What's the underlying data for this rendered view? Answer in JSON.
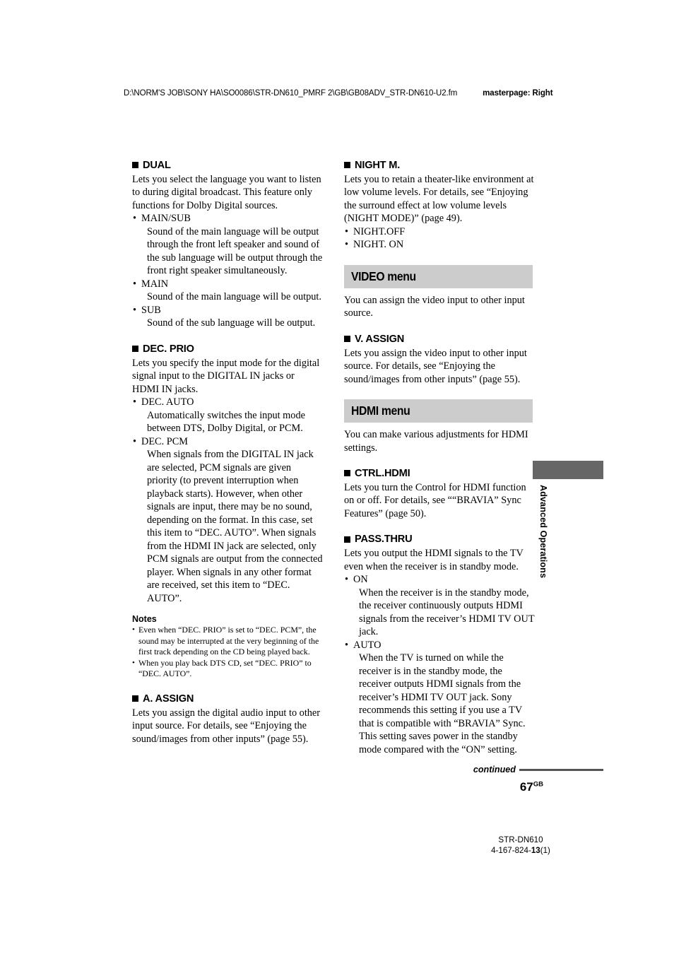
{
  "header": {
    "file_path": "D:\\NORM'S JOB\\SONY HA\\SO0086\\STR-DN610_PMRF 2\\GB\\GB08ADV_STR-DN610-U2.fm",
    "masterpage": "masterpage: Right"
  },
  "side_tab": {
    "label": "Advanced Operations",
    "block_color": "#666666"
  },
  "menu_bar_color": "#cccccc",
  "left_column": {
    "dual": {
      "heading": "DUAL",
      "intro": "Lets you select the language you want to listen to during digital broadcast. This feature only functions for Dolby Digital sources.",
      "options": [
        {
          "name": "MAIN/SUB",
          "desc": "Sound of the main language will be output through the front left speaker and sound of the sub language will be output through the front right speaker simultaneously."
        },
        {
          "name": "MAIN",
          "desc": "Sound of the main language will be output."
        },
        {
          "name": "SUB",
          "desc": "Sound of the sub language will be output."
        }
      ]
    },
    "dec_prio": {
      "heading": "DEC. PRIO",
      "intro": "Lets you specify the input mode for the digital signal input to the DIGITAL IN jacks or HDMI IN jacks.",
      "options": [
        {
          "name": "DEC. AUTO",
          "desc": "Automatically switches the input mode between DTS, Dolby Digital, or PCM."
        },
        {
          "name": "DEC. PCM",
          "desc": "When signals from the DIGITAL IN jack are selected, PCM signals are given priority (to prevent interruption when playback starts). However, when other signals are input, there may be no sound, depending on the format. In this case, set this item to “DEC. AUTO”. When signals from the HDMI IN jack are selected, only PCM signals are output from the connected player. When signals in any other format are received, set this item to “DEC. AUTO”."
        }
      ],
      "notes_title": "Notes",
      "notes": [
        "Even when “DEC. PRIO” is set to “DEC. PCM”, the sound may be interrupted at the very beginning of the first track depending on the CD being played back.",
        "When you play back DTS CD, set “DEC. PRIO” to “DEC. AUTO”."
      ]
    },
    "a_assign": {
      "heading": "A. ASSIGN",
      "intro": "Lets you assign the digital audio input to other input source. For details, see “Enjoying the sound/images from other inputs” (page 55)."
    }
  },
  "right_column": {
    "night_m": {
      "heading": "NIGHT M.",
      "intro": "Lets you to retain a theater-like environment at low volume levels. For details, see “Enjoying the surround effect at low volume levels (NIGHT MODE)” (page 49).",
      "options": [
        {
          "name": "NIGHT.OFF",
          "desc": ""
        },
        {
          "name": "NIGHT. ON",
          "desc": ""
        }
      ]
    },
    "video_menu": {
      "bar_title": "VIDEO menu",
      "intro": "You can assign the video input to other input source.",
      "v_assign": {
        "heading": "V. ASSIGN",
        "intro": "Lets you assign the video input to other input source. For details, see “Enjoying the sound/images from other inputs” (page 55)."
      }
    },
    "hdmi_menu": {
      "bar_title": "HDMI menu",
      "intro": "You can make various adjustments for HDMI settings.",
      "ctrl_hdmi": {
        "heading": "CTRL.HDMI",
        "intro": "Lets you turn the Control for HDMI function on or off. For details, see ““BRAVIA” Sync Features” (page 50)."
      },
      "pass_thru": {
        "heading": "PASS.THRU",
        "intro": "Lets you output the HDMI signals to the TV even when the receiver is in standby mode.",
        "options": [
          {
            "name": "ON",
            "desc": "When the receiver is in the standby mode, the receiver continuously outputs HDMI signals from the receiver’s HDMI TV OUT jack."
          },
          {
            "name": "AUTO",
            "desc": "When the TV is turned on while the receiver is in the standby mode, the receiver outputs HDMI signals from the receiver’s HDMI TV OUT jack. Sony recommends this setting if you use a TV that is compatible with “BRAVIA” Sync. This setting saves power in the standby mode compared with the “ON” setting."
          }
        ]
      }
    }
  },
  "continued": {
    "label": "continued",
    "page_number": "67",
    "page_suffix": "GB"
  },
  "footer": {
    "model": "STR-DN610",
    "part_prefix": "4-167-824-",
    "part_bold": "13",
    "part_suffix": "(1)"
  }
}
